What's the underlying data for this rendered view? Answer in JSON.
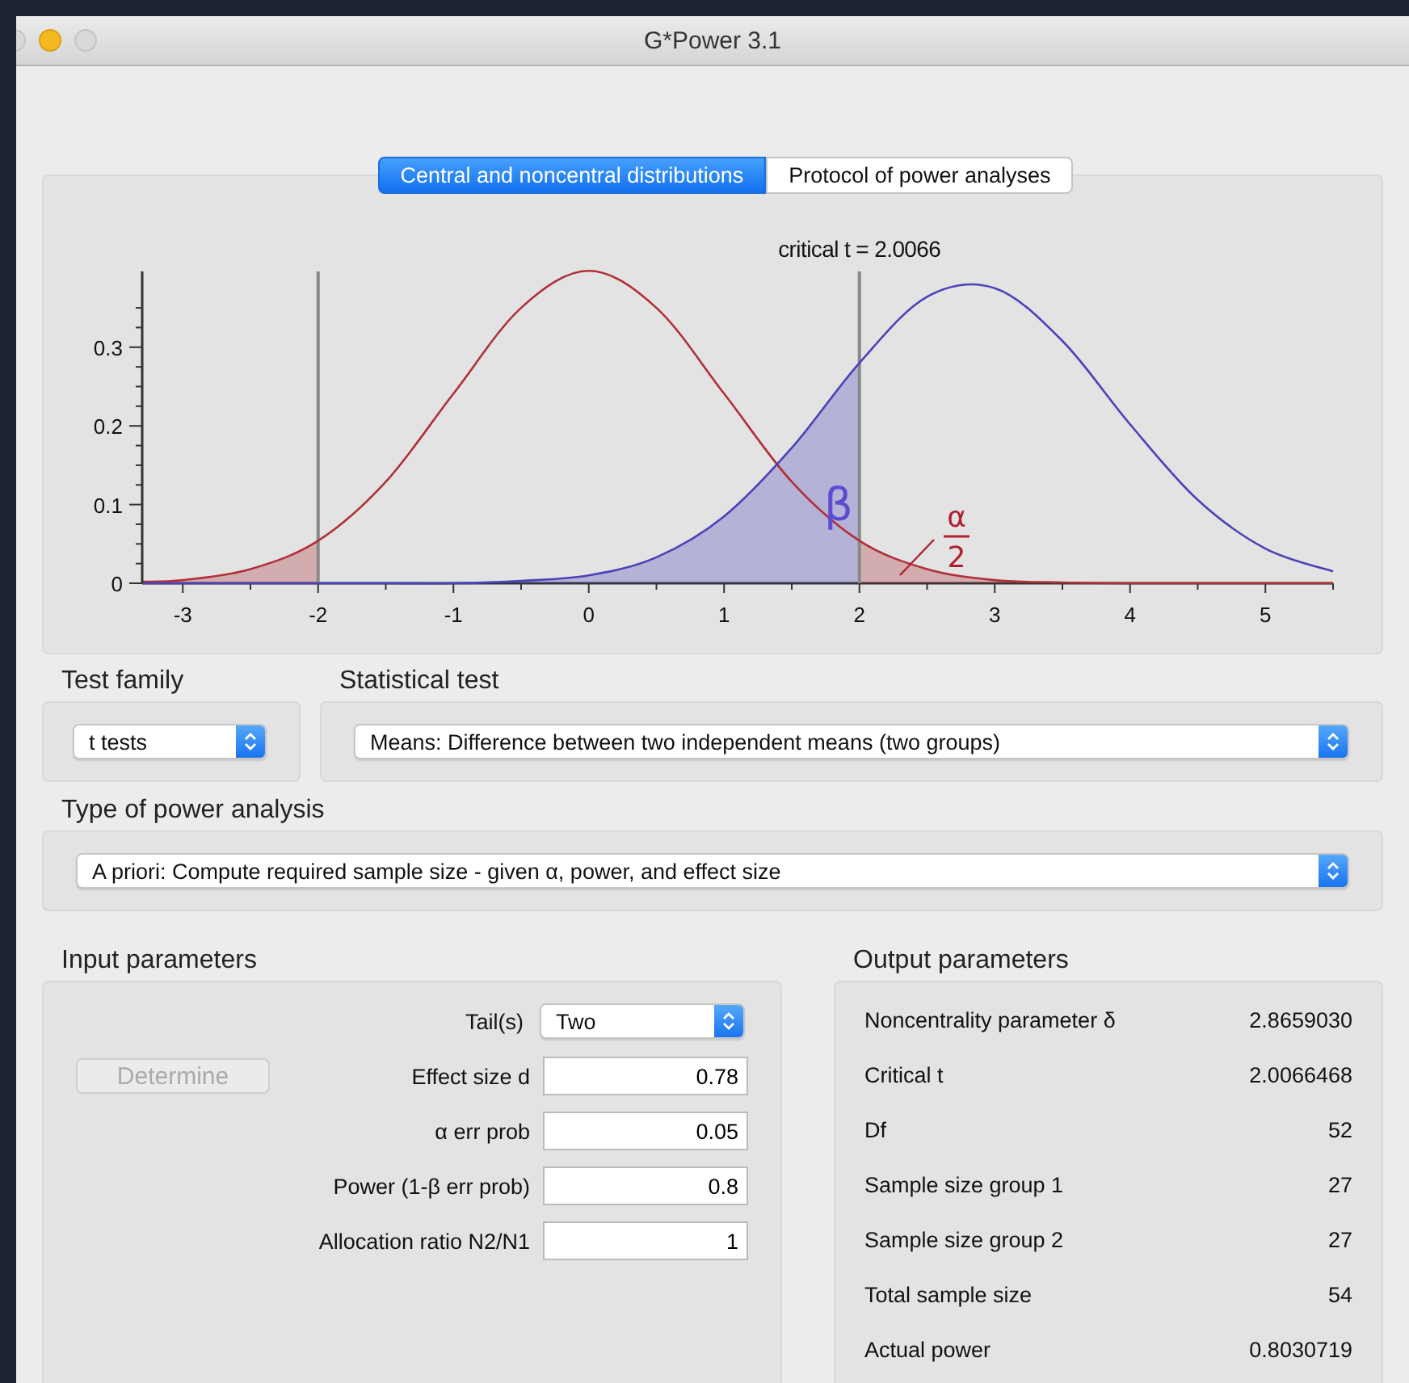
{
  "window": {
    "title": "G*Power 3.1"
  },
  "tabs": [
    {
      "label": "Central and noncentral distributions",
      "selected": true
    },
    {
      "label": "Protocol of power analyses",
      "selected": false
    }
  ],
  "distribution_plot": {
    "chart_data": {
      "type": "line",
      "xlim": [
        -3.3,
        5.5
      ],
      "ylim": [
        0,
        0.4
      ],
      "xticks": [
        -3,
        -2,
        -1,
        0,
        1,
        2,
        3,
        4,
        5
      ],
      "yticks": [
        0,
        0.1,
        0.2,
        0.3
      ],
      "x": [
        -3.3,
        -3,
        -2.5,
        -2,
        -1.5,
        -1,
        -0.5,
        0,
        0.5,
        1,
        1.5,
        2,
        2.5,
        3,
        3.5,
        4,
        4.5,
        5,
        5.5
      ],
      "series": [
        {
          "color": "#b03038",
          "values": [
            0.002,
            0.004,
            0.018,
            0.054,
            0.129,
            0.241,
            0.35,
            0.397,
            0.35,
            0.241,
            0.129,
            0.054,
            0.018,
            0.004,
            0.001,
            0,
            0,
            0,
            0
          ]
        },
        {
          "color": "#4a42b8",
          "values": [
            0,
            0,
            0,
            0,
            0,
            0,
            0.003,
            0.01,
            0.033,
            0.085,
            0.172,
            0.28,
            0.364,
            0.375,
            0.308,
            0.202,
            0.106,
            0.044,
            0.015
          ]
        }
      ],
      "ref_lines": [
        {
          "axis": "x",
          "value": -2
        },
        {
          "axis": "x",
          "value": 2
        }
      ],
      "annotations": [
        "critical t = 2.0066",
        "β",
        "α",
        "2"
      ]
    }
  },
  "test_family": {
    "label": "Test family",
    "value": "t tests"
  },
  "statistical_test": {
    "label": "Statistical test",
    "value": "Means: Difference between two independent means (two groups)"
  },
  "power_analysis_type": {
    "label": "Type of power analysis",
    "value": "A priori: Compute required sample size - given α, power, and effect size"
  },
  "input_parameters": {
    "title": "Input parameters",
    "determine_button": {
      "label": "Determine",
      "disabled": true
    },
    "fields": [
      {
        "kind": "select",
        "label": "Tail(s)",
        "value": "Two"
      },
      {
        "kind": "input",
        "label": "Effect size d",
        "value": "0.78"
      },
      {
        "kind": "input",
        "label": "α err prob",
        "value": "0.05"
      },
      {
        "kind": "input",
        "label": "Power (1-β err prob)",
        "value": "0.8"
      },
      {
        "kind": "input",
        "label": "Allocation ratio N2/N1",
        "value": "1"
      }
    ]
  },
  "output_parameters": {
    "title": "Output parameters",
    "rows": [
      {
        "label": "Noncentrality parameter δ",
        "value": "2.8659030"
      },
      {
        "label": "Critical t",
        "value": "2.0066468"
      },
      {
        "label": "Df",
        "value": "52"
      },
      {
        "label": "Sample size group 1",
        "value": "27"
      },
      {
        "label": "Sample size group 2",
        "value": "27"
      },
      {
        "label": "Total sample size",
        "value": "54"
      },
      {
        "label": "Actual power",
        "value": "0.8030719"
      }
    ]
  }
}
